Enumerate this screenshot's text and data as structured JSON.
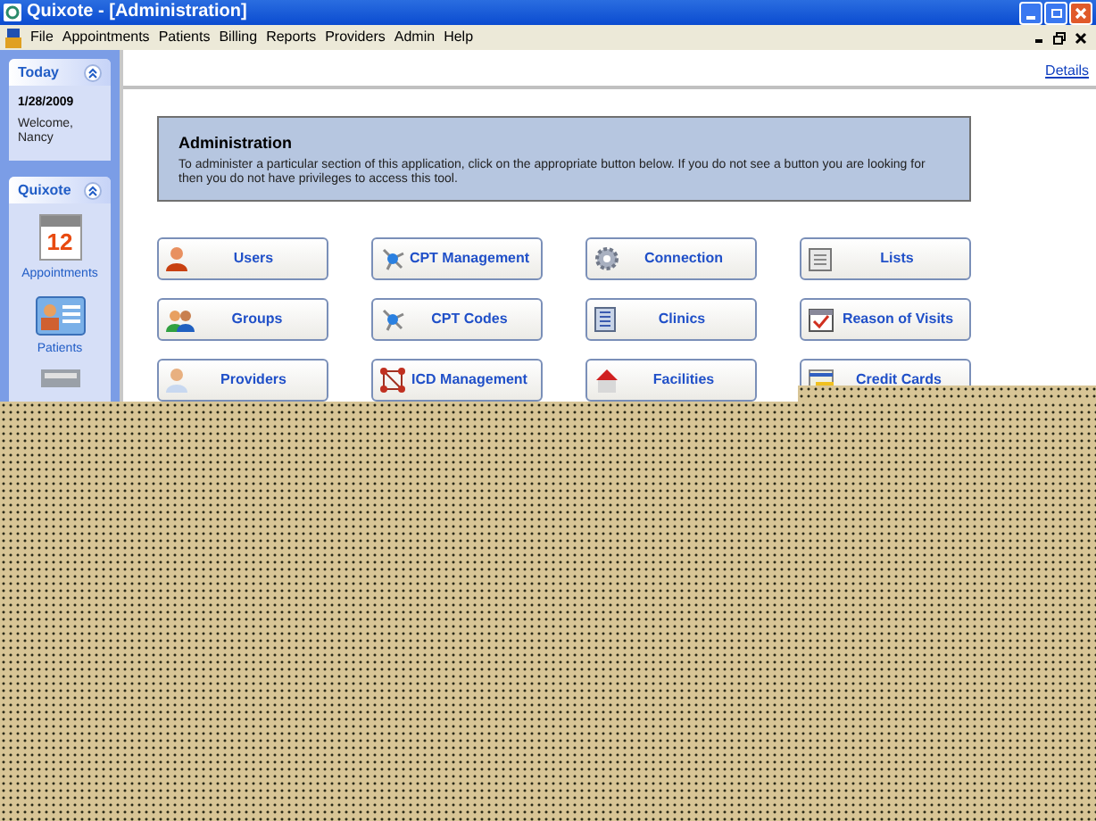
{
  "window": {
    "title": "Quixote - [Administration]"
  },
  "menu": [
    "File",
    "Appointments",
    "Patients",
    "Billing",
    "Reports",
    "Providers",
    "Admin",
    "Help"
  ],
  "sidebar": {
    "today": {
      "title": "Today",
      "date": "1/28/2009",
      "welcome": "Welcome,",
      "user": "Nancy",
      "expanded": true
    },
    "quixote": {
      "title": "Quixote",
      "expanded": true,
      "calendar_day": "12",
      "items": [
        {
          "label": "Appointments"
        },
        {
          "label": "Patients"
        }
      ]
    }
  },
  "details_link": "Details",
  "admin": {
    "title": "Administration",
    "text": "To administer a particular section of this application, click on the appropriate button below.  If you do not see a button you are looking for then you do not have privileges to access this tool."
  },
  "buttons": [
    {
      "label": "Users"
    },
    {
      "label": "CPT Management"
    },
    {
      "label": "Connection"
    },
    {
      "label": "Lists"
    },
    {
      "label": "Groups"
    },
    {
      "label": "CPT Codes"
    },
    {
      "label": "Clinics"
    },
    {
      "label": "Reason of Visits"
    },
    {
      "label": "Providers"
    },
    {
      "label": "ICD Management"
    },
    {
      "label": "Facilities"
    },
    {
      "label": "Credit Cards"
    }
  ]
}
